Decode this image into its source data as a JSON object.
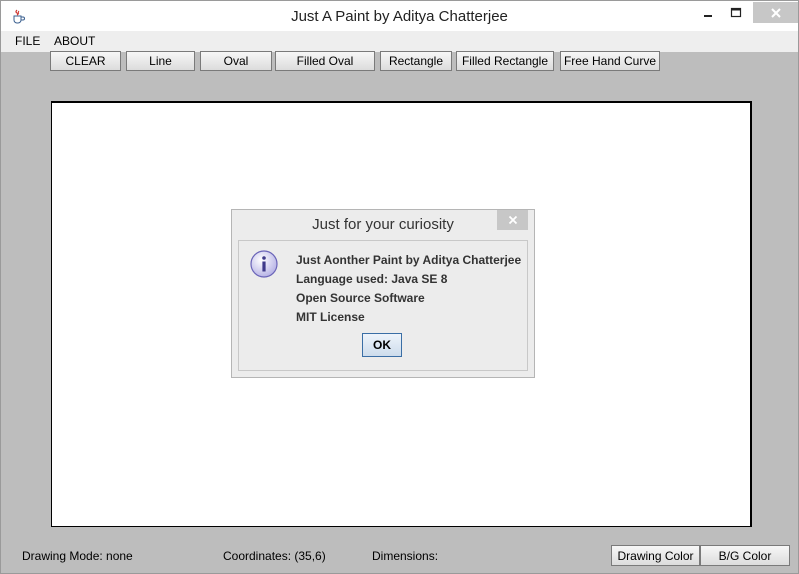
{
  "window": {
    "title": "Just A Paint by Aditya Chatterjee",
    "icon": "java-cup-icon"
  },
  "menu": {
    "file": "FILE",
    "about": "ABOUT"
  },
  "toolbar": {
    "clear": "CLEAR",
    "line": "Line",
    "oval": "Oval",
    "filled_oval": "Filled Oval",
    "rectangle": "Rectangle",
    "filled_rectangle": "Filled Rectangle",
    "free_hand_curve": "Free Hand Curve"
  },
  "dialog": {
    "title": "Just for your curiosity",
    "icon": "info-icon",
    "lines": [
      "Just Aonther Paint by Aditya Chatterjee",
      "Language used: Java SE 8",
      "Open Source Software",
      "MIT License"
    ],
    "ok": "OK"
  },
  "status": {
    "drawing_mode": "Drawing Mode: none",
    "coordinates": "Coordinates: (35,6)",
    "dimensions": "Dimensions:"
  },
  "bottom_buttons": {
    "drawing_color": "Drawing Color",
    "bg_color": "B/G Color"
  },
  "colors": {
    "frame_background": "#bdbdbd",
    "canvas": "#ffffff",
    "dialog_background": "#ececec",
    "title_close_button": "#c7c7c7"
  }
}
